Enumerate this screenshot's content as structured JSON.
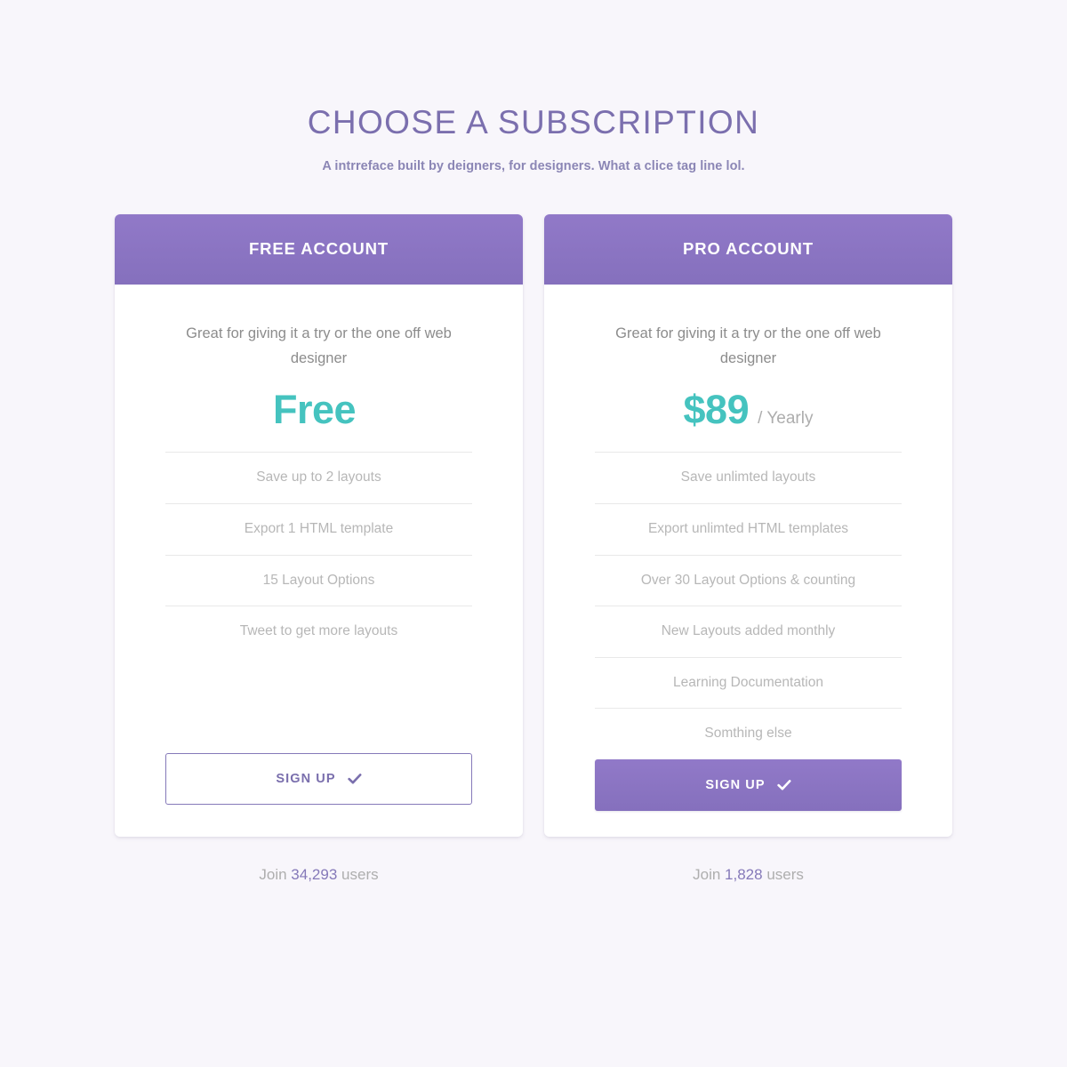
{
  "header": {
    "title": "CHOOSE A SUBSCRIPTION",
    "subtitle": "A intrreface built by deigners, for designers. What a clice tag line lol."
  },
  "colors": {
    "background": "#f8f6fb",
    "purple": "#8570bd",
    "purple_light": "#9179c8",
    "teal": "#45c3bf",
    "title_purple": "#7b6fae",
    "muted_gray": "#b7b7b7"
  },
  "plans": [
    {
      "id": "free",
      "header_label": "FREE ACCOUNT",
      "description": "Great for giving it a try or the one off web designer",
      "price_amount": "Free",
      "price_period": "",
      "features": [
        "Save up to 2 layouts",
        "Export 1 HTML template",
        "15 Layout Options",
        "Tweet to get more layouts"
      ],
      "cta_label": "SIGN UP",
      "cta_icon": "check-icon",
      "join_prefix": "Join",
      "join_count": "34,293",
      "join_suffix": "users"
    },
    {
      "id": "pro",
      "header_label": "PRO ACCOUNT",
      "description": "Great for giving it a try or the one off web designer",
      "price_amount": "$89",
      "price_period": "/ Yearly",
      "features": [
        "Save unlimted layouts",
        "Export unlimted HTML templates",
        "Over 30 Layout Options & counting",
        "New Layouts added monthly",
        "Learning Documentation",
        "Somthing else"
      ],
      "cta_label": "SIGN UP",
      "cta_icon": "check-icon",
      "join_prefix": "Join",
      "join_count": "1,828",
      "join_suffix": "users"
    }
  ]
}
